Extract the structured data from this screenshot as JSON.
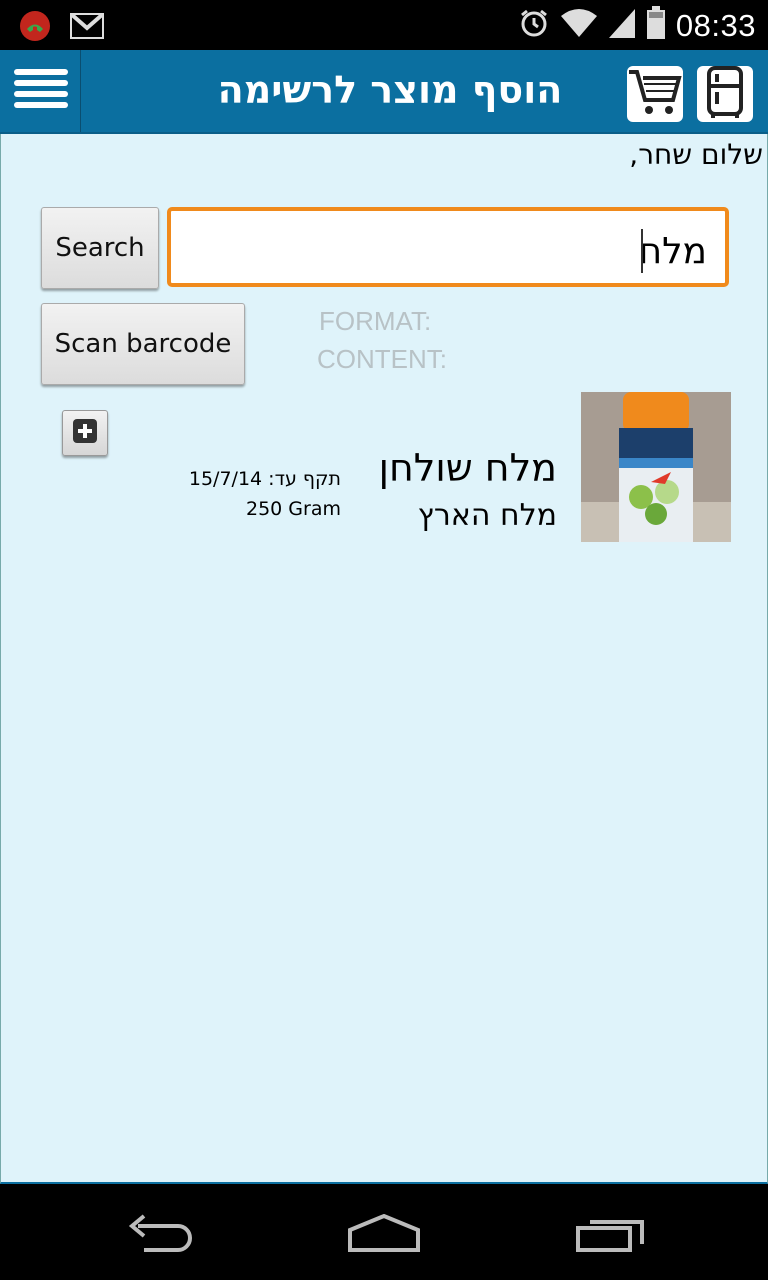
{
  "status_bar": {
    "time": "08:33",
    "left_icons": [
      "missed-call-icon",
      "gmail-icon"
    ],
    "right_icons": [
      "alarm-icon",
      "wifi-icon",
      "signal-icon",
      "battery-icon"
    ]
  },
  "app_bar": {
    "title": "הוסף מוצר לרשימה",
    "color": "#0b6fa0"
  },
  "greeting": "שלום שחר,",
  "search": {
    "button_label": "Search",
    "input_value": "מלח"
  },
  "scan": {
    "button_label": "Scan barcode",
    "format_label": "FORMAT:",
    "content_label": "CONTENT:"
  },
  "results": [
    {
      "name": "מלח שולחן",
      "brand": "מלח הארץ",
      "expiry": "תקף עד: 15/7/14",
      "size": "250 Gram"
    }
  ],
  "colors": {
    "content_bg": "#dff3fa",
    "input_border": "#f08a1c"
  }
}
